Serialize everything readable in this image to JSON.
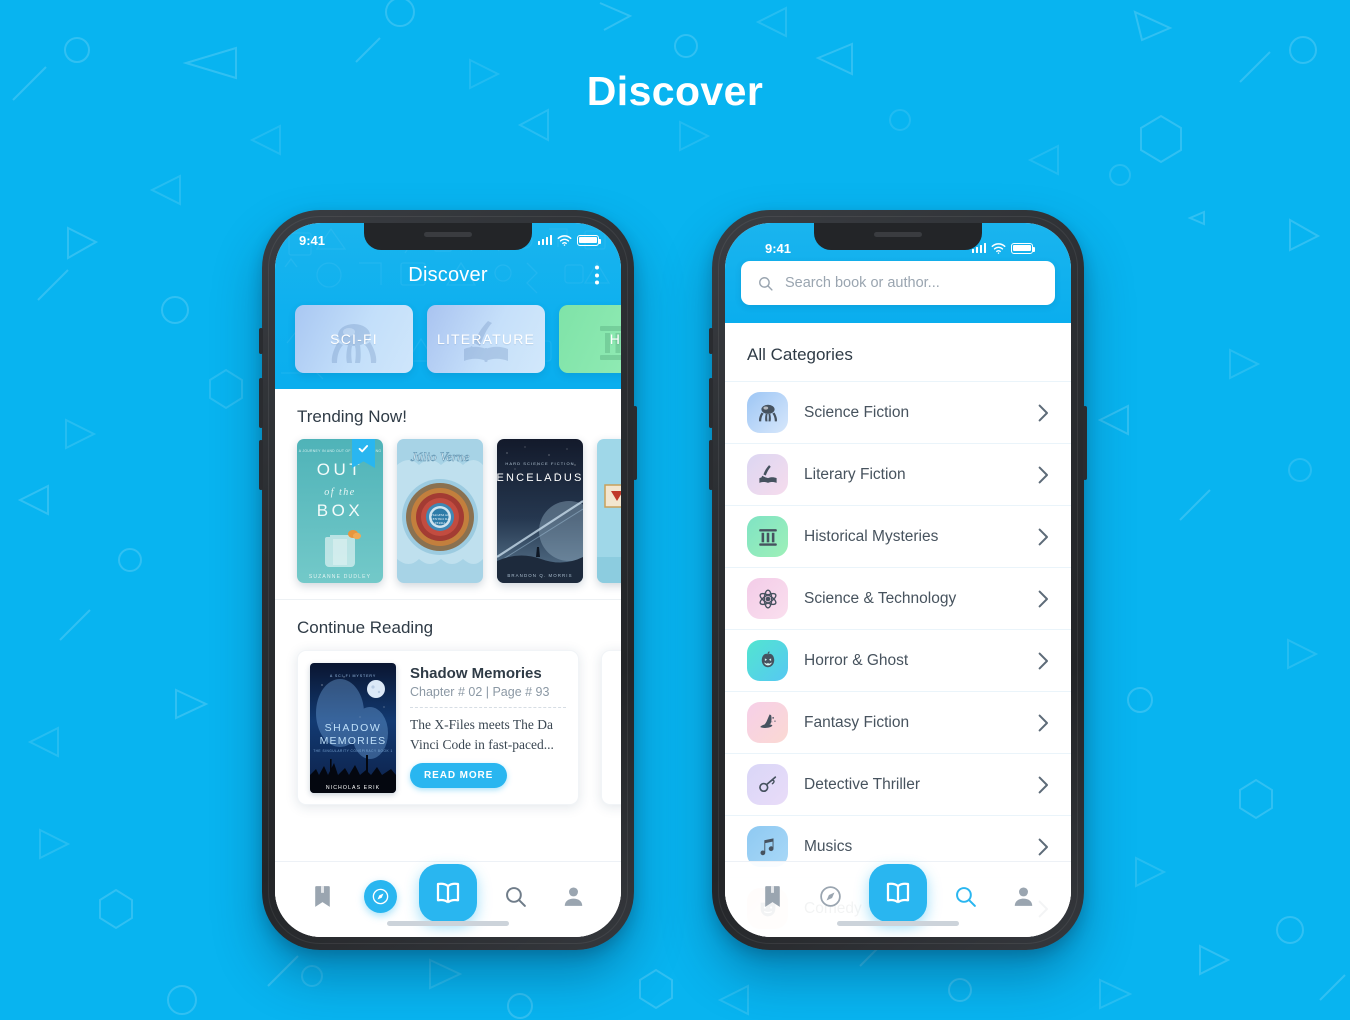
{
  "page": {
    "title": "Discover",
    "background_color": "#08b4f0",
    "accent_color": "#29b6f0"
  },
  "status_bar": {
    "time": "9:41"
  },
  "left_phone": {
    "appbar": {
      "title": "Discover",
      "menu_icon": "kebab-menu-icon"
    },
    "chips": [
      {
        "label": "SCI-FI",
        "glyph": "alien-icon",
        "color": "#c3dffa"
      },
      {
        "label": "LITERATURE",
        "glyph": "quill-book-icon",
        "color": "#c6e0fa"
      },
      {
        "label": "HI",
        "glyph": "pillar-icon",
        "color": "#7fe3a8"
      }
    ],
    "trending": {
      "heading": "Trending Now!",
      "books": [
        {
          "title": "OUT of the BOX",
          "author": "SUZANNE DUDLEY",
          "badge": "bookmark-check-icon"
        },
        {
          "title": "Júlio Verne",
          "author": ""
        },
        {
          "title": "ENCELADUS",
          "kicker": "HARD SCIENCE FICTION",
          "author": "BRANDON Q. MORRIS"
        },
        {
          "title": "",
          "author": ""
        }
      ]
    },
    "continue_reading": {
      "heading": "Continue Reading",
      "card": {
        "cover_kicker": "A SCI-FI MYSTERY",
        "cover_title": "SHADOW MEMORIES",
        "cover_series": "THE SINGULARITY CONSPIRACY BOOK 1",
        "cover_author": "NICHOLAS ERIK",
        "title": "Shadow Memories",
        "meta": "Chapter # 02 | Page # 93",
        "description": "The X-Files meets The Da Vinci Code in fast-paced...",
        "button": "READ MORE"
      }
    },
    "tabbar": [
      {
        "name": "bookmark",
        "icon": "bookmark-icon",
        "active": false
      },
      {
        "name": "compass",
        "icon": "compass-icon",
        "active": true
      },
      {
        "name": "library",
        "icon": "open-book-icon",
        "active": true
      },
      {
        "name": "search",
        "icon": "search-icon",
        "active": false
      },
      {
        "name": "profile",
        "icon": "person-icon",
        "active": false
      }
    ]
  },
  "right_phone": {
    "search": {
      "placeholder": "Search book or author...",
      "value": "",
      "icon": "search-icon"
    },
    "categories": {
      "heading": "All Categories",
      "items": [
        {
          "label": "Science Fiction",
          "icon": "alien-icon",
          "color_a": "#9dc6f5",
          "color_b": "#d7e7fb"
        },
        {
          "label": "Literary Fiction",
          "icon": "quill-book-icon",
          "color_a": "#dcd6f2",
          "color_b": "#f6dced"
        },
        {
          "label": "Historical Mysteries",
          "icon": "pillar-icon",
          "color_a": "#7fe3c4",
          "color_b": "#9ef0b8"
        },
        {
          "label": "Science & Technology",
          "icon": "atom-icon",
          "color_a": "#f3cce8",
          "color_b": "#fadfee"
        },
        {
          "label": "Horror & Ghost",
          "icon": "pumpkin-icon",
          "color_a": "#52e5d0",
          "color_b": "#56c8f2"
        },
        {
          "label": "Fantasy Fiction",
          "icon": "wizard-hat-icon",
          "color_a": "#f6cfe8",
          "color_b": "#fbd9d3"
        },
        {
          "label": "Detective Thriller",
          "icon": "magnifier-pipe-icon",
          "color_a": "#d9d6f7",
          "color_b": "#e9dcf8"
        },
        {
          "label": "Musics",
          "icon": "music-icon",
          "color_a": "#8ec9f2",
          "color_b": "#a9d8f7"
        },
        {
          "label": "Comedy",
          "icon": "mask-icon",
          "color_a": "#f2d2c6",
          "color_b": "#f8e2d6"
        }
      ],
      "chevron_icon": "chevron-right-icon"
    },
    "tabbar": [
      {
        "name": "bookmark",
        "icon": "bookmark-icon",
        "active": false
      },
      {
        "name": "compass",
        "icon": "compass-icon",
        "active": false
      },
      {
        "name": "library",
        "icon": "open-book-icon",
        "active": true
      },
      {
        "name": "search",
        "icon": "search-icon",
        "active": true
      },
      {
        "name": "profile",
        "icon": "person-icon",
        "active": false
      }
    ]
  }
}
